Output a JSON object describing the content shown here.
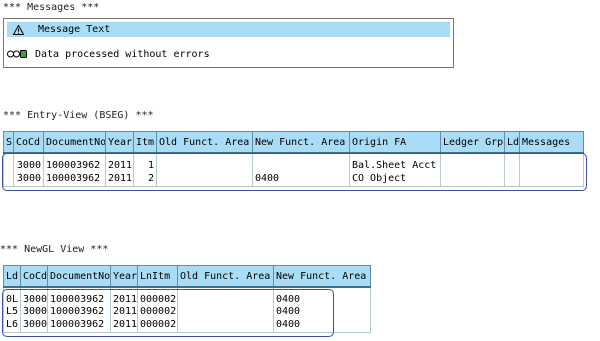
{
  "messages": {
    "title": "*** Messages ***",
    "header_icon": "warning-triangle-icon",
    "header_label": "Message Text",
    "rows": [
      {
        "icon": "traffic-light-green-icon",
        "text": "Data processed without errors"
      }
    ]
  },
  "entry_view": {
    "title": "*** Entry-View (BSEG) ***",
    "columns": [
      "S",
      "CoCd",
      "DocumentNo",
      "Year",
      "Itm",
      "Old Funct. Area",
      "New Funct. Area",
      "Origin FA",
      "Ledger Grp",
      "Ld",
      "Messages"
    ],
    "rows": [
      [
        "",
        "3000",
        "100003962",
        "2011",
        "1",
        "",
        "",
        "Bal.Sheet Acct",
        "",
        "",
        ""
      ],
      [
        "",
        "3000",
        "100003962",
        "2011",
        "2",
        "",
        "0400",
        "CO Object",
        "",
        "",
        ""
      ]
    ]
  },
  "newgl_view": {
    "title": "*** NewGL View ***",
    "columns": [
      "Ld",
      "CoCd",
      "DocumentNo",
      "Year",
      "LnItm",
      "Old Funct. Area",
      "New Funct. Area"
    ],
    "rows": [
      [
        "0L",
        "3000",
        "100003962",
        "2011",
        "000002",
        "",
        "0400"
      ],
      [
        "L5",
        "3000",
        "100003962",
        "2011",
        "000002",
        "",
        "0400"
      ],
      [
        "L6",
        "3000",
        "100003962",
        "2011",
        "000002",
        "",
        "0400"
      ]
    ]
  },
  "colors": {
    "header_bg": "#a9ddf7",
    "highlight_frame": "#3d4fa8",
    "traffic_green": "#2fa83a"
  }
}
